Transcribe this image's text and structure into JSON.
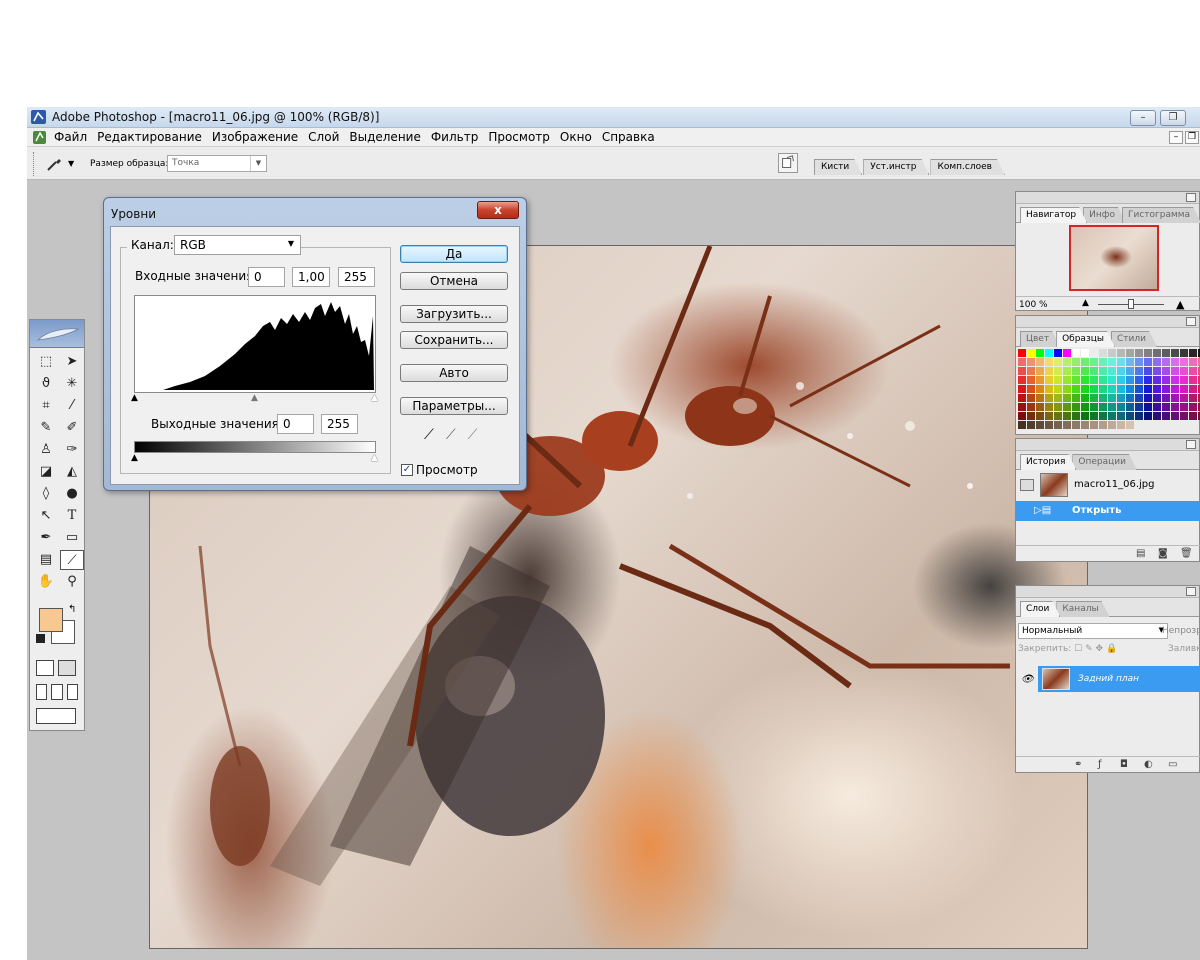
{
  "window": {
    "title": "Adobe Photoshop - [macro11_06.jpg @ 100% (RGB/8)]",
    "minimize": "–",
    "restore": "❐"
  },
  "menu": {
    "items": [
      "Файл",
      "Редактирование",
      "Изображение",
      "Слой",
      "Выделение",
      "Фильтр",
      "Просмотр",
      "Окно",
      "Справка"
    ],
    "mdi_minimize": "–",
    "mdi_restore": "❐"
  },
  "options": {
    "sample_label": "Размер образца:",
    "sample_value": "Точка",
    "well_tabs": [
      "Кисти",
      "Уст.инстр",
      "Комп.слоев"
    ]
  },
  "levels": {
    "title": "Уровни",
    "close": "x",
    "channel_label": "Канал:",
    "channel_value": "RGB",
    "input_label": "Входные значения:",
    "input_black": "0",
    "input_gamma": "1,00",
    "input_white": "255",
    "output_label": "Выходные значения:",
    "output_black": "0",
    "output_white": "255",
    "buttons": {
      "ok": "Да",
      "cancel": "Отмена",
      "load": "Загрузить...",
      "save": "Сохранить...",
      "auto": "Авто",
      "options": "Параметры..."
    },
    "preview_label": "Просмотр",
    "preview_checked": true
  },
  "navigator": {
    "tabs": [
      "Навигатор",
      "Инфо",
      "Гистограмма"
    ],
    "zoom": "100 %"
  },
  "swatches": {
    "tabs": [
      "Цвет",
      "Образцы",
      "Стили"
    ]
  },
  "history": {
    "tabs": [
      "История",
      "Операции"
    ],
    "snapshot": "macro11_06.jpg",
    "state": "Открыть"
  },
  "layers": {
    "tabs": [
      "Слои",
      "Каналы"
    ],
    "blend_mode": "Нормальный",
    "opacity_label": "Непрозр",
    "lock_label": "Закрепить:",
    "fill_label": "Заливк",
    "layer_name": "Задний план"
  },
  "colors": {
    "foreground": "#f7c88f",
    "background": "#ffffff",
    "selection": "#3a9bf0"
  }
}
